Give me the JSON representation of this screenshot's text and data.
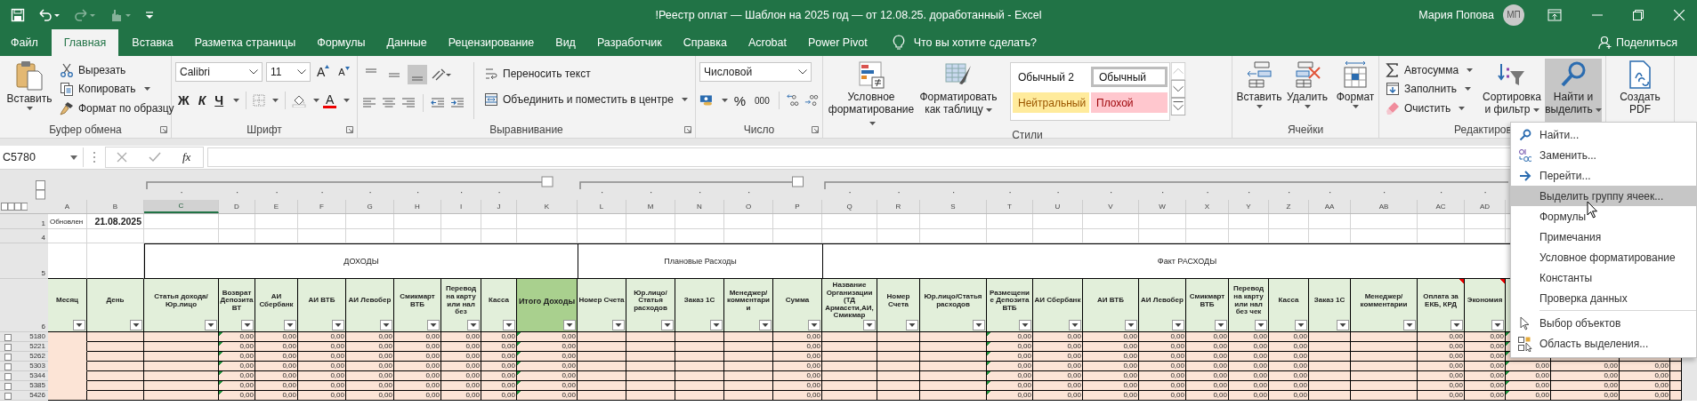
{
  "window": {
    "title": "!Реестр оплат  — Шаблон на 2025 год — от 12.08.25. доработанный  -  Excel",
    "user": "Мария Попова",
    "avatar": "МП"
  },
  "quick_access": [
    {
      "kind": "save",
      "disabled": false
    },
    {
      "kind": "undo",
      "disabled": false
    },
    {
      "kind": "redo",
      "disabled": true
    },
    {
      "kind": "touch",
      "disabled": true
    },
    {
      "kind": "customize",
      "disabled": false
    }
  ],
  "tabs": [
    {
      "label": "Файл",
      "selected": false
    },
    {
      "label": "Главная",
      "selected": true
    },
    {
      "label": "Вставка",
      "selected": false
    },
    {
      "label": "Разметка страницы",
      "selected": false
    },
    {
      "label": "Формулы",
      "selected": false
    },
    {
      "label": "Данные",
      "selected": false
    },
    {
      "label": "Рецензирование",
      "selected": false
    },
    {
      "label": "Вид",
      "selected": false
    },
    {
      "label": "Разработчик",
      "selected": false
    },
    {
      "label": "Справка",
      "selected": false
    },
    {
      "label": "Acrobat",
      "selected": false
    },
    {
      "label": "Power Pivot",
      "selected": false
    }
  ],
  "tell_me": "Что вы хотите сделать?",
  "share": "Поделиться",
  "ribbon": {
    "clipboard": {
      "paste": "Вставить",
      "cut": "Вырезать",
      "copy": "Копировать",
      "format_painter": "Формат по образцу",
      "label": "Буфер обмена"
    },
    "font": {
      "name": "Calibri",
      "size": "11",
      "grow": "A",
      "shrink": "A",
      "bold": "Ж",
      "italic": "К",
      "underline": "Ч",
      "font_color_letter": "A",
      "label": "Шрифт"
    },
    "alignment": {
      "vertical": [
        {
          "kind": "top",
          "selected": false
        },
        {
          "kind": "middle",
          "selected": false
        },
        {
          "kind": "bottom",
          "selected": true
        }
      ],
      "wrap": "Переносить текст",
      "merge": "Объединить и поместить в центре",
      "label": "Выравнивание"
    },
    "number": {
      "format": "Числовой",
      "percent": "%",
      "thousands": "000",
      "label": "Число"
    },
    "styles": {
      "conditional": "Условное форматирование",
      "as_table": "Форматировать как таблицу",
      "gallery": [
        {
          "label": "Обычный 2",
          "kind": "plain",
          "selected": false
        },
        {
          "label": "Обычный",
          "kind": "plain",
          "selected": true
        },
        {
          "label": "Нейтральный",
          "kind": "neutral",
          "selected": false
        },
        {
          "label": "Плохой",
          "kind": "bad",
          "selected": false
        }
      ],
      "label": "Стили"
    },
    "cells": {
      "insert": "Вставить",
      "delete": "Удалить",
      "format": "Формат",
      "label": "Ячейки"
    },
    "editing": {
      "autosum": "Автосумма",
      "fill": "Заполнить",
      "clear": "Очистить",
      "sort": "Сортировка и фильтр",
      "find": "Найти и выделить",
      "find_pressed": true,
      "label": "Редактиров"
    },
    "pdf": {
      "create": "Создать PDF"
    }
  },
  "formula_bar": {
    "name_box": "C5780",
    "function": "fx"
  },
  "sheet": {
    "updated_label": "Обновлен",
    "updated_date": "21.08.2025",
    "row_labels": [
      "1",
      "4",
      "5",
      "6"
    ],
    "sections": [
      "ДОХОДЫ",
      "Плановые Расходы",
      "Факт РАСХОДЫ"
    ],
    "columns": [
      {
        "letter": "A",
        "header": "Месяц",
        "kind": "filter",
        "selected": false,
        "highlight": false,
        "error_mark": false,
        "comment": false
      },
      {
        "letter": "B",
        "header": "День",
        "kind": "filter",
        "selected": false,
        "highlight": false,
        "error_mark": false,
        "comment": false
      },
      {
        "letter": "C",
        "header": "Статья дохода/Юр.лицо",
        "kind": "filter",
        "selected": true,
        "highlight": false,
        "error_mark": false,
        "comment": false
      },
      {
        "letter": "D",
        "header": "Возврат Депозита ВТ",
        "kind": "filter",
        "selected": false,
        "highlight": false,
        "error_mark": true,
        "comment": false
      },
      {
        "letter": "E",
        "header": "АИ Сбербанк",
        "kind": "filter",
        "selected": false,
        "highlight": false,
        "error_mark": false,
        "comment": false
      },
      {
        "letter": "F",
        "header": "АИ ВТБ",
        "kind": "filter",
        "selected": false,
        "highlight": false,
        "error_mark": false,
        "comment": false
      },
      {
        "letter": "G",
        "header": "АИ Левобер",
        "kind": "filter",
        "selected": false,
        "highlight": false,
        "error_mark": false,
        "comment": false
      },
      {
        "letter": "H",
        "header": "Смикмарт ВТБ",
        "kind": "filter",
        "selected": false,
        "highlight": false,
        "error_mark": false,
        "comment": false
      },
      {
        "letter": "I",
        "header": "Перевод на карту или нал без",
        "kind": "filter",
        "selected": false,
        "highlight": false,
        "error_mark": false,
        "comment": false
      },
      {
        "letter": "J",
        "header": "Касса",
        "kind": "filter",
        "selected": false,
        "highlight": false,
        "error_mark": false,
        "comment": false
      },
      {
        "letter": "K",
        "header": "Итого Доходы",
        "kind": "filter",
        "selected": false,
        "highlight": true,
        "error_mark": true,
        "comment": false
      },
      {
        "letter": "L",
        "header": "Номер Счета",
        "kind": "filter",
        "selected": false,
        "highlight": false,
        "error_mark": false,
        "comment": false
      },
      {
        "letter": "M",
        "header": "Юр.лицо/Статья расходов",
        "kind": "filter",
        "selected": false,
        "highlight": false,
        "error_mark": false,
        "comment": false
      },
      {
        "letter": "N",
        "header": "Заказ 1С",
        "kind": "filter",
        "selected": false,
        "highlight": false,
        "error_mark": false,
        "comment": false
      },
      {
        "letter": "O",
        "header": "Менеджер/комментарии",
        "kind": "filter",
        "selected": false,
        "highlight": false,
        "error_mark": false,
        "comment": false
      },
      {
        "letter": "P",
        "header": "Сумма",
        "kind": "filter",
        "selected": false,
        "highlight": false,
        "error_mark": false,
        "comment": false
      },
      {
        "letter": "Q",
        "header": "Название Организации (ТД Армасети,АИ, Смикмар",
        "kind": "filter",
        "selected": false,
        "highlight": false,
        "error_mark": false,
        "comment": false
      },
      {
        "letter": "R",
        "header": "Номер Счета",
        "kind": "filter",
        "selected": false,
        "highlight": false,
        "error_mark": false,
        "comment": false
      },
      {
        "letter": "S",
        "header": "Юр.лицо/Статья расходов",
        "kind": "filter",
        "selected": false,
        "highlight": false,
        "error_mark": false,
        "comment": false
      },
      {
        "letter": "T",
        "header": "Размещение Депозита ВТБ",
        "kind": "filter",
        "selected": false,
        "highlight": false,
        "error_mark": true,
        "comment": false
      },
      {
        "letter": "U",
        "header": "АИ Сбербанк",
        "kind": "filter",
        "selected": false,
        "highlight": false,
        "error_mark": false,
        "comment": false
      },
      {
        "letter": "V",
        "header": "АИ ВТБ",
        "kind": "filter",
        "selected": false,
        "highlight": false,
        "error_mark": false,
        "comment": false
      },
      {
        "letter": "W",
        "header": "АИ Левобер",
        "kind": "filter",
        "selected": false,
        "highlight": false,
        "error_mark": false,
        "comment": false
      },
      {
        "letter": "X",
        "header": "Смикмарт ВТБ",
        "kind": "filter",
        "selected": false,
        "highlight": false,
        "error_mark": false,
        "comment": false
      },
      {
        "letter": "Y",
        "header": "Перевод на карту или нал без чек",
        "kind": "filter",
        "selected": false,
        "highlight": false,
        "error_mark": false,
        "comment": false
      },
      {
        "letter": "Z",
        "header": "Касса",
        "kind": "filter",
        "selected": false,
        "highlight": false,
        "error_mark": false,
        "comment": false
      },
      {
        "letter": "AA",
        "header": "Заказ 1С",
        "kind": "filter",
        "selected": false,
        "highlight": false,
        "error_mark": false,
        "comment": false
      },
      {
        "letter": "AB",
        "header": "Менеджер/комментарии",
        "kind": "filter",
        "selected": false,
        "highlight": false,
        "error_mark": false,
        "comment": false
      },
      {
        "letter": "AC",
        "header": "Оплата за ЕКБ, КРД",
        "kind": "filter",
        "selected": false,
        "highlight": false,
        "error_mark": false,
        "comment": true
      },
      {
        "letter": "AD",
        "header": "Экономия",
        "kind": "filter",
        "selected": false,
        "highlight": false,
        "error_mark": false,
        "comment": true
      },
      {
        "kind": "covered",
        "error_mark": true
      },
      {
        "kind": "covered",
        "error_mark": false
      },
      {
        "kind": "covered",
        "error_mark": false
      },
      {
        "kind": "covered",
        "error_mark": false
      }
    ],
    "rows": [
      {
        "number": "5180",
        "cells": [
          null,
          null,
          null,
          "0,00",
          "0,00",
          "0,00",
          "0,00",
          "0,00",
          "0,00",
          "0,00",
          "0,00",
          null,
          null,
          null,
          null,
          "0,00",
          null,
          null,
          null,
          "0,00",
          "0,00",
          "0,00",
          "0,00",
          "0,00",
          "0,00",
          "0,00",
          null,
          null,
          "0,00",
          "0,00",
          null,
          null,
          null,
          null
        ]
      },
      {
        "number": "5221",
        "cells": [
          null,
          null,
          null,
          "0,00",
          "0,00",
          "0,00",
          "0,00",
          "0,00",
          "0,00",
          "0,00",
          "0,00",
          null,
          null,
          null,
          null,
          "0,00",
          null,
          null,
          null,
          "0,00",
          "0,00",
          "0,00",
          "0,00",
          "0,00",
          "0,00",
          "0,00",
          null,
          null,
          "0,00",
          "0,00",
          null,
          null,
          null,
          null
        ]
      },
      {
        "number": "5262",
        "cells": [
          null,
          null,
          null,
          "0,00",
          "0,00",
          "0,00",
          "0,00",
          "0,00",
          "0,00",
          "0,00",
          "0,00",
          null,
          null,
          null,
          null,
          "0,00",
          null,
          null,
          null,
          "0,00",
          "0,00",
          "0,00",
          "0,00",
          "0,00",
          "0,00",
          "0,00",
          null,
          null,
          "0,00",
          "0,00",
          null,
          null,
          null,
          null
        ]
      },
      {
        "number": "5303",
        "cells": [
          null,
          null,
          null,
          "0,00",
          "0,00",
          "0,00",
          "0,00",
          "0,00",
          "0,00",
          "0,00",
          "0,00",
          null,
          null,
          null,
          null,
          "0,00",
          null,
          null,
          null,
          "0,00",
          "0,00",
          "0,00",
          "0,00",
          "0,00",
          "0,00",
          "0,00",
          null,
          null,
          "0,00",
          "0,00",
          "0,00",
          "0,00",
          "0,00",
          null
        ]
      },
      {
        "number": "5344",
        "cells": [
          null,
          null,
          null,
          "0,00",
          "0,00",
          "0,00",
          "0,00",
          "0,00",
          "0,00",
          "0,00",
          "0,00",
          null,
          null,
          null,
          null,
          "0,00",
          null,
          null,
          null,
          "0,00",
          "0,00",
          "0,00",
          "0,00",
          "0,00",
          "0,00",
          "0,00",
          null,
          null,
          "0,00",
          "0,00",
          "0,00",
          "0,00",
          "0,00",
          null
        ]
      },
      {
        "number": "5385",
        "cells": [
          null,
          null,
          null,
          "0,00",
          "0,00",
          "0,00",
          "0,00",
          "0,00",
          "0,00",
          "0,00",
          "0,00",
          null,
          null,
          null,
          null,
          "0,00",
          null,
          null,
          null,
          "0,00",
          "0,00",
          "0,00",
          "0,00",
          "0,00",
          "0,00",
          "0,00",
          null,
          null,
          "0,00",
          "0,00",
          "0,00",
          "0,00",
          "0,00",
          null
        ]
      },
      {
        "number": "5426",
        "cells": [
          null,
          null,
          null,
          "0,00",
          "0,00",
          "0,00",
          "0,00",
          "0,00",
          "0,00",
          "0,00",
          "0,00",
          null,
          null,
          null,
          null,
          "0,00",
          null,
          null,
          null,
          "0,00",
          "0,00",
          "0,00",
          "0,00",
          "0,00",
          "0,00",
          "0,00",
          null,
          null,
          "0,00",
          "0,00",
          "0,00",
          "0,00",
          "0,00",
          null
        ]
      }
    ]
  },
  "find_menu": [
    {
      "items": [
        {
          "label": "Найти...",
          "kind": "search",
          "selected": false
        },
        {
          "label": "Заменить...",
          "kind": "replace",
          "selected": false
        },
        {
          "label": "Перейти...",
          "kind": "goto",
          "selected": false
        },
        {
          "label": "Выделить группу ячеек...",
          "kind": "plain",
          "selected": true
        },
        {
          "label": "Формулы",
          "kind": "plain",
          "selected": false
        },
        {
          "label": "Примечания",
          "kind": "plain",
          "selected": false
        },
        {
          "label": "Условное форматирование",
          "kind": "plain",
          "selected": false
        },
        {
          "label": "Константы",
          "kind": "plain",
          "selected": false
        },
        {
          "label": "Проверка данных",
          "kind": "plain",
          "selected": false
        }
      ]
    },
    {
      "items": [
        {
          "label": "Выбор объектов",
          "kind": "pointer",
          "selected": false
        },
        {
          "label": "Область выделения...",
          "kind": "pane",
          "selected": false
        }
      ]
    }
  ]
}
